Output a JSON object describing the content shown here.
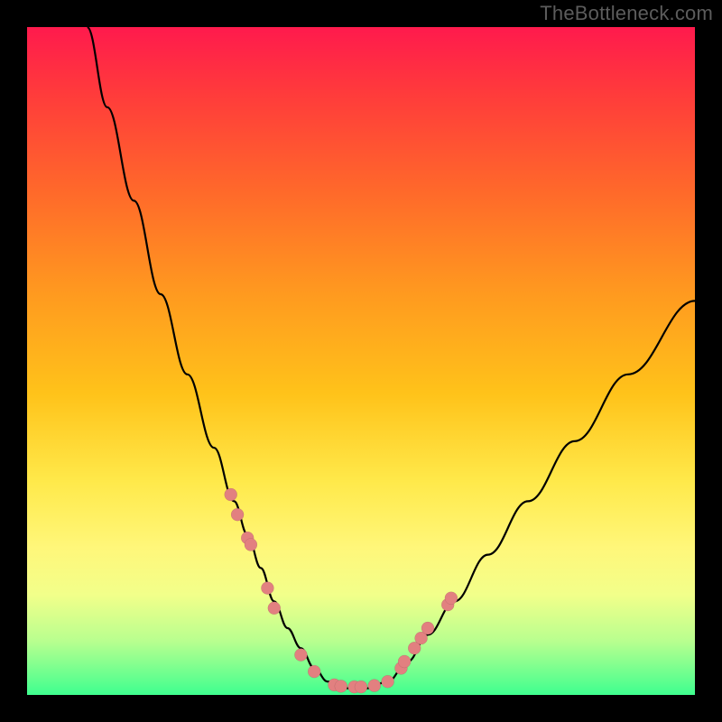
{
  "watermark": "TheBottleneck.com",
  "chart_data": {
    "type": "line",
    "title": "",
    "xlabel": "",
    "ylabel": "",
    "xlim": [
      0,
      100
    ],
    "ylim": [
      0,
      100
    ],
    "grid": false,
    "legend": false,
    "series": [
      {
        "name": "curve",
        "x": [
          9,
          12,
          16,
          20,
          24,
          28,
          31,
          33,
          35,
          37,
          39,
          41,
          43,
          45,
          48,
          51,
          54,
          57,
          60,
          64,
          69,
          75,
          82,
          90,
          100
        ],
        "y": [
          100,
          88,
          74,
          60,
          48,
          37,
          29,
          24,
          19,
          14,
          10,
          7,
          4,
          2,
          1,
          1,
          2,
          5,
          9,
          14,
          21,
          29,
          38,
          48,
          59
        ]
      }
    ],
    "dots": {
      "name": "markers",
      "x": [
        30.5,
        31.5,
        33,
        33.5,
        36,
        37,
        41,
        43,
        46,
        47,
        49,
        50,
        52,
        54,
        56,
        56.5,
        58,
        59,
        60,
        63,
        63.5
      ],
      "y": [
        30,
        27,
        23.5,
        22.5,
        16,
        13,
        6,
        3.5,
        1.5,
        1.3,
        1.2,
        1.2,
        1.4,
        2,
        4,
        5,
        7,
        8.5,
        10,
        13.5,
        14.5
      ],
      "r": 7
    },
    "background": "vertical-gradient red→green"
  }
}
